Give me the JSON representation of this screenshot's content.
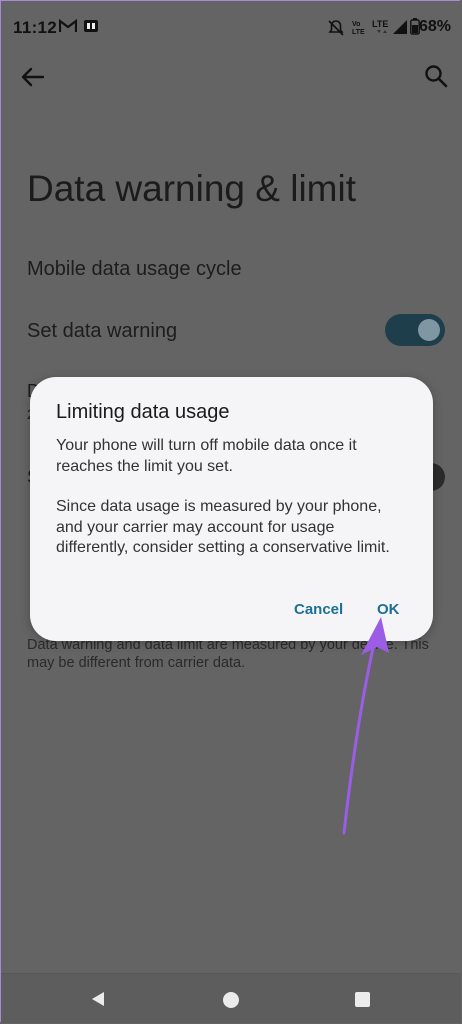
{
  "status_bar": {
    "time": "11:12",
    "battery": "68%",
    "icons": [
      "gmail-icon",
      "sim-icon",
      "mute-icon",
      "volte-icon",
      "lte-icon",
      "signal-icon",
      "battery-icon"
    ]
  },
  "app_bar": {
    "back_icon": "arrow-left-icon",
    "search_icon": "search-icon"
  },
  "page": {
    "title": "Data warning & limit",
    "rows": [
      {
        "label": "Mobile data usage cycle"
      },
      {
        "label": "Set data warning",
        "toggle_on": true
      }
    ],
    "partial_text": {
      "row3_a": "D",
      "row3_b": "2",
      "row4": "S",
      "row5": "D"
    },
    "footer_note": "Data warning and data limit are measured by your device. This may be different from carrier data."
  },
  "dialog": {
    "title": "Limiting data usage",
    "paragraphs": [
      "Your phone will turn off mobile data once it reaches the limit you set.",
      "Since data usage is measured by your phone, and your carrier may account for usage differently, consider setting a conservative limit."
    ],
    "cancel_label": "Cancel",
    "ok_label": "OK"
  },
  "annotation": {
    "arrow_color": "#9b5de5"
  },
  "nav_bar": {
    "icons": [
      "back-triangle-icon",
      "home-circle-icon",
      "recents-square-icon"
    ]
  }
}
